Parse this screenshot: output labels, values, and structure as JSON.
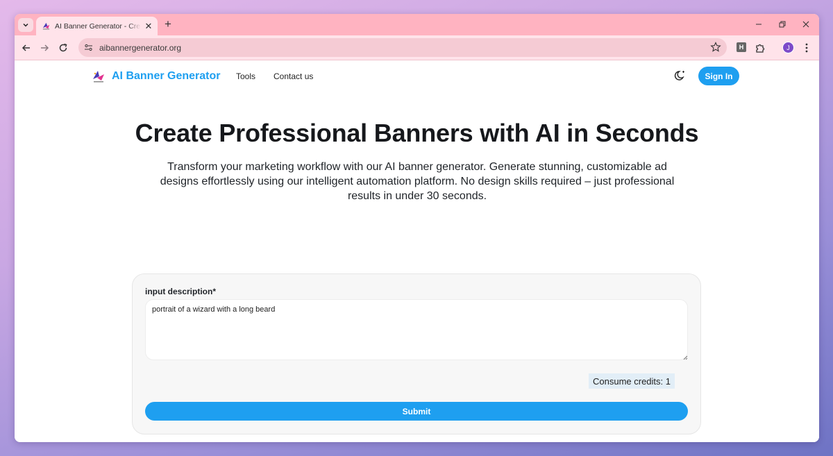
{
  "browser": {
    "tab_title": "AI Banner Generator - Create Professional Banners with AI in Seconds",
    "url": "aibannergenerator.org",
    "profile_initial": "J",
    "extension_letter": "H"
  },
  "nav": {
    "brand": "AI Banner Generator",
    "links": [
      "Tools",
      "Contact us"
    ],
    "sign_in": "Sign In"
  },
  "hero": {
    "title": "Create Professional Banners with AI in Seconds",
    "subtitle": "Transform your marketing workflow with our AI banner generator. Generate stunning, customizable ad designs effortlessly using our intelligent automation platform. No design skills required – just professional results in under 30 seconds."
  },
  "form": {
    "label": "input description*",
    "value": "portrait of a wizard with a long beard",
    "credits": "Consume credits: 1",
    "submit": "Submit"
  },
  "colors": {
    "accent": "#1e9ff0",
    "tabstrip": "#ffb3c1",
    "toolbar": "#ffe3ea"
  }
}
